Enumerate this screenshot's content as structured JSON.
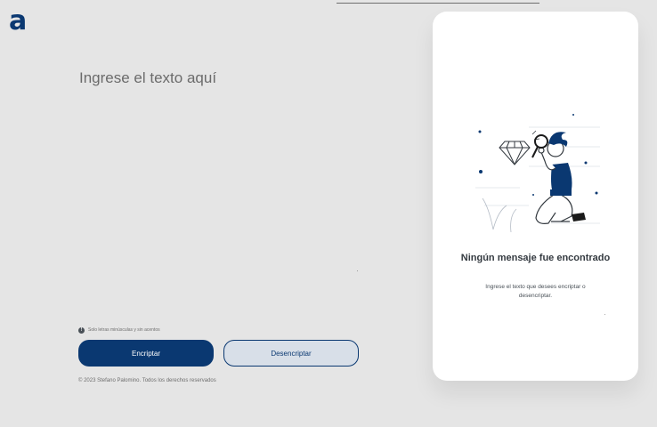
{
  "brand": {
    "logo_text": "a",
    "color": "#0a3871"
  },
  "input": {
    "placeholder": "Ingrese el texto aquí",
    "value": ""
  },
  "hint": {
    "icon": "info-icon",
    "text": "Solo letras minúsculas y sin acentos"
  },
  "buttons": {
    "encrypt_label": "Encriptar",
    "decrypt_label": "Desencriptar"
  },
  "footer": {
    "text": "© 2023 Stefano Palomino. Todos los derechos reservados"
  },
  "output": {
    "illustration": "person-searching-illustration",
    "title": "Ningún mensaje fue encontrado",
    "message": "Ingrese el texto que desees encriptar o desencriptar."
  },
  "colors": {
    "primary": "#0a3871",
    "background": "#e5e5e5",
    "card": "#ffffff",
    "secondary_button": "#d8dfe8"
  }
}
